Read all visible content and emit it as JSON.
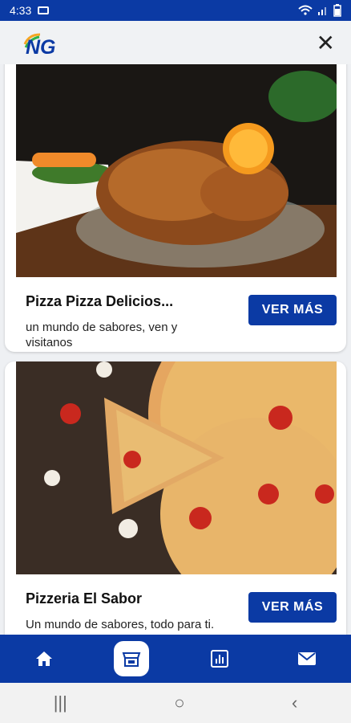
{
  "status": {
    "time": "4:33"
  },
  "header": {
    "logo_text": "NG"
  },
  "cards": [
    {
      "title": "Pizza Pizza Delicios...",
      "description": "un mundo de sabores, ven y visitanos",
      "button": "VER MÁS"
    },
    {
      "title": "Pizzeria El Sabor",
      "description": "Un mundo de sabores, todo para ti.",
      "button": "VER MÁS"
    }
  ],
  "nav": {
    "items": [
      "home-icon",
      "store-icon",
      "chart-icon",
      "mail-icon"
    ],
    "active": "store-icon"
  },
  "colors": {
    "brand": "#0b3aa4"
  }
}
